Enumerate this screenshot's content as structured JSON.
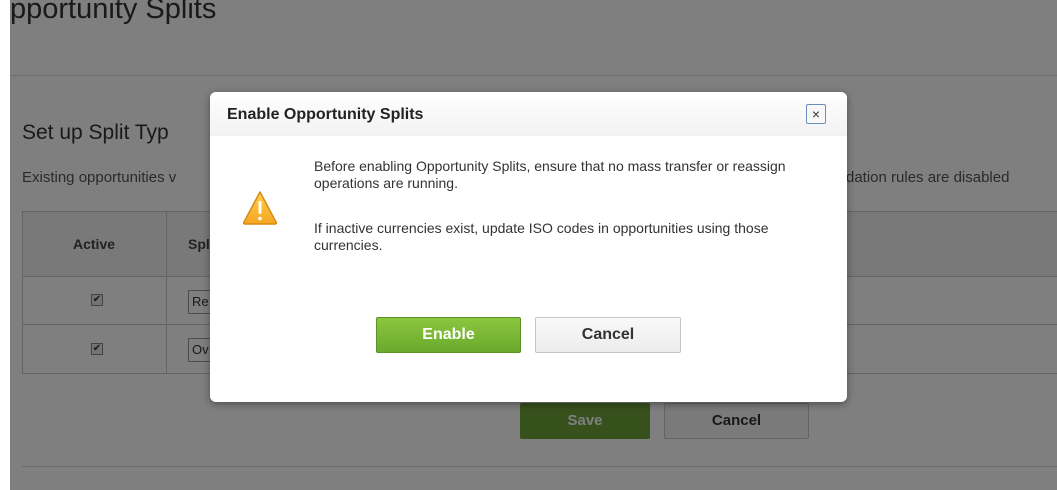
{
  "page": {
    "title": "pportunity Splits",
    "section_title": "Set up Split Typ",
    "description_left": "Existing opportunities v",
    "description_right": "dation rules are disabled"
  },
  "table": {
    "headers": {
      "active": "Active",
      "split": "Spl"
    },
    "rows": [
      {
        "active": "✔",
        "name": "Re"
      },
      {
        "active": "✔",
        "name": "Ov"
      }
    ]
  },
  "background_buttons": {
    "save": "Save",
    "cancel": "Cancel"
  },
  "modal": {
    "title": "Enable Opportunity Splits",
    "close": "×",
    "message1": "Before enabling Opportunity Splits, ensure that no mass transfer or reassign operations are running.",
    "message2": "If inactive currencies exist, update ISO codes in opportunities using those currencies.",
    "enable_label": "Enable",
    "cancel_label": "Cancel",
    "icon": "warning-icon"
  },
  "colors": {
    "accent_green": "#6aa92d",
    "overlay": "rgba(0,0,0,0.5)"
  }
}
